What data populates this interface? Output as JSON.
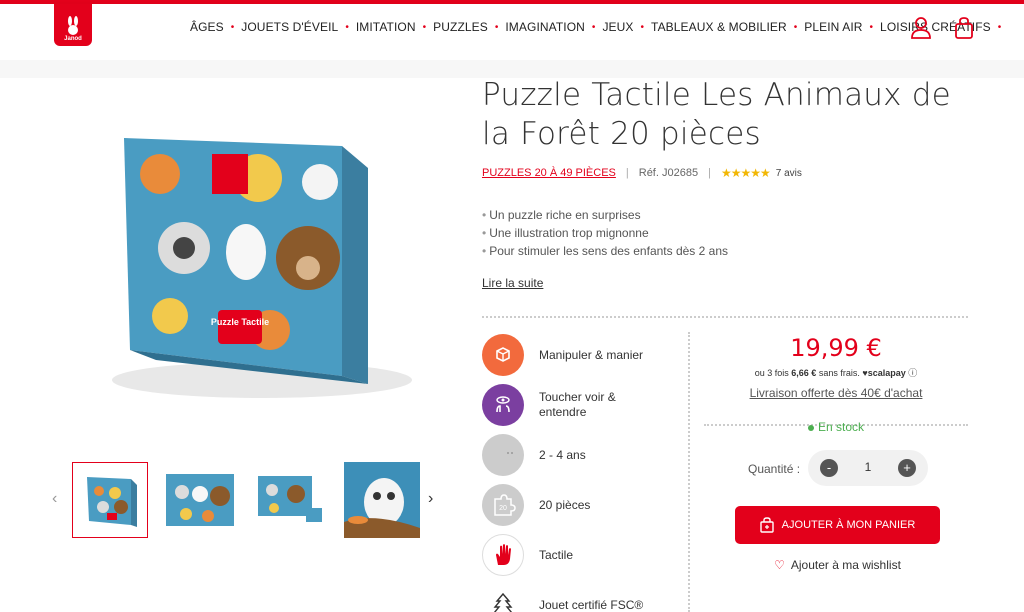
{
  "brand": {
    "logo_text": "Janod"
  },
  "nav": {
    "items": [
      {
        "label": "ÂGES"
      },
      {
        "label": "JOUETS D'ÉVEIL"
      },
      {
        "label": "IMITATION"
      },
      {
        "label": "PUZZLES"
      },
      {
        "label": "IMAGINATION"
      },
      {
        "label": "JEUX"
      },
      {
        "label": "TABLEAUX & MOBILIER"
      },
      {
        "label": "PLEIN AIR"
      },
      {
        "label": "LOISIRS CRÉATIFS"
      }
    ],
    "separator": "•"
  },
  "product": {
    "title": "Puzzle Tactile Les Animaux de la Forêt 20 pièces",
    "category": "PUZZLES 20 À 49 PIÈCES",
    "ref": "Réf. J02685",
    "rating": 4.5,
    "stars": "★★★★★",
    "reviews": "7 avis",
    "bullets": [
      "Un puzzle riche en surprises",
      "Une illustration trop mignonne",
      "Pour stimuler les sens des enfants dès 2 ans"
    ],
    "read_more": "Lire la suite",
    "box_text": "Puzzle Tactile",
    "badge_20": "20"
  },
  "features": [
    {
      "label": "Manipuler & manier",
      "icon": "cube-hand-icon",
      "color": "#f26a3d"
    },
    {
      "label": "Toucher voir & entendre",
      "icon": "senses-icon",
      "color": "#7b3fa0"
    },
    {
      "label": "2 - 4 ans",
      "icon": "moon-face-icon",
      "color": "#cccccc"
    },
    {
      "label": "20 pièces",
      "icon": "puzzle-piece-icon",
      "color": "#cccccc"
    },
    {
      "label": "Tactile",
      "icon": "hand-icon",
      "color": "#e3001b"
    },
    {
      "label": "Jouet certifié FSC®",
      "icon": "fsc-tree-icon",
      "color": "#333333"
    }
  ],
  "purchase": {
    "price": "19,99 €",
    "scalapay_prefix": "ou 3 fois",
    "scalapay_amount": "6,66 €",
    "scalapay_suffix": "sans frais.",
    "scalapay_brand": "scalapay",
    "scalapay_info": "ⓘ",
    "delivery": "Livraison offerte dès 40€ d'achat",
    "stock": "En stock",
    "quantity_label": "Quantité :",
    "quantity": "1",
    "minus": "-",
    "plus": "+",
    "add_to_cart": "AJOUTER À MON PANIER",
    "wishlist": "Ajouter à ma wishlist"
  },
  "colors": {
    "accent": "#e3001b",
    "stock": "#4caf50",
    "stars": "#f2b705"
  }
}
